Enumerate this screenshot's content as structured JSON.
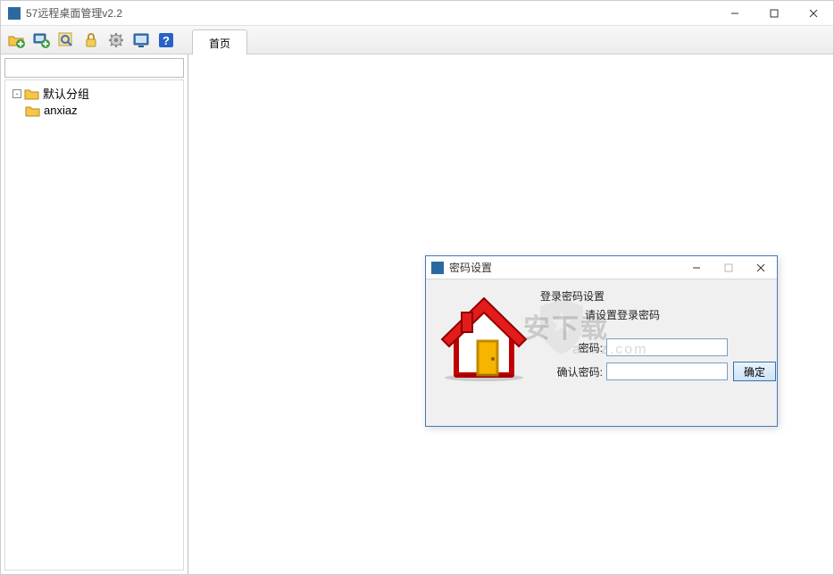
{
  "app": {
    "title": "57远程桌面管理v2.2"
  },
  "tabs": [
    {
      "label": "首页"
    }
  ],
  "sidebar": {
    "items": [
      {
        "label": "默认分组"
      },
      {
        "label": "anxiaz"
      }
    ]
  },
  "dialog": {
    "title": "密码设置",
    "heading": "登录密码设置",
    "subheading": "请设置登录密码",
    "password_label": "密码:",
    "confirm_label": "确认密码:",
    "password_value": "",
    "confirm_value": "",
    "button_label": "确定"
  },
  "watermark": {
    "main": "安下载",
    "sub": "anxz.com"
  }
}
